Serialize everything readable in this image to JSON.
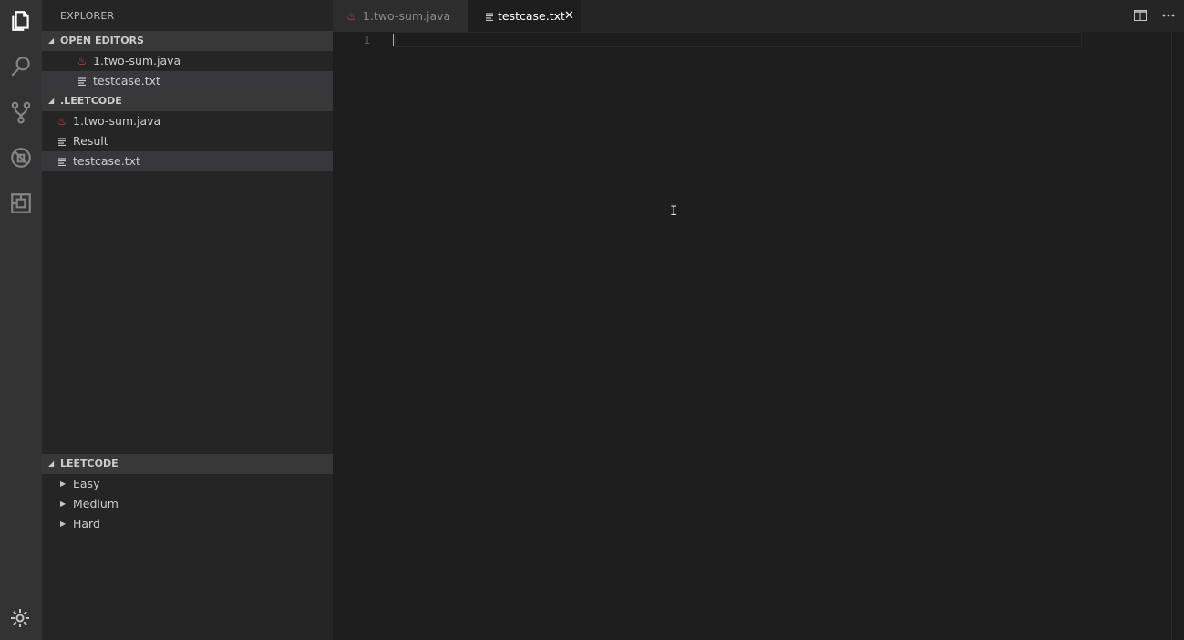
{
  "sidebar": {
    "title": "EXPLORER",
    "open_editors": {
      "header": "OPEN EDITORS",
      "items": [
        {
          "label": "1.two-sum.java",
          "icon": "java-icon"
        },
        {
          "label": "testcase.txt",
          "icon": "text-file-icon"
        }
      ]
    },
    "workspace": {
      "header": ".LEETCODE",
      "items": [
        {
          "label": "1.two-sum.java",
          "icon": "java-icon"
        },
        {
          "label": "Result",
          "icon": "text-file-icon"
        },
        {
          "label": "testcase.txt",
          "icon": "text-file-icon"
        }
      ]
    },
    "leetcode": {
      "header": "LEETCODE",
      "items": [
        {
          "label": "Easy"
        },
        {
          "label": "Medium"
        },
        {
          "label": "Hard"
        }
      ]
    }
  },
  "tabs": [
    {
      "label": "1.two-sum.java",
      "icon": "java-icon",
      "active": false
    },
    {
      "label": "testcase.txt",
      "icon": "text-file-icon",
      "active": true,
      "close": "✕"
    }
  ],
  "editor": {
    "line_numbers": [
      "1"
    ]
  },
  "colors": {
    "activity_bar": "#333333",
    "sidebar": "#252526",
    "editor": "#1e1e1e",
    "java_icon": "#d9443a"
  }
}
